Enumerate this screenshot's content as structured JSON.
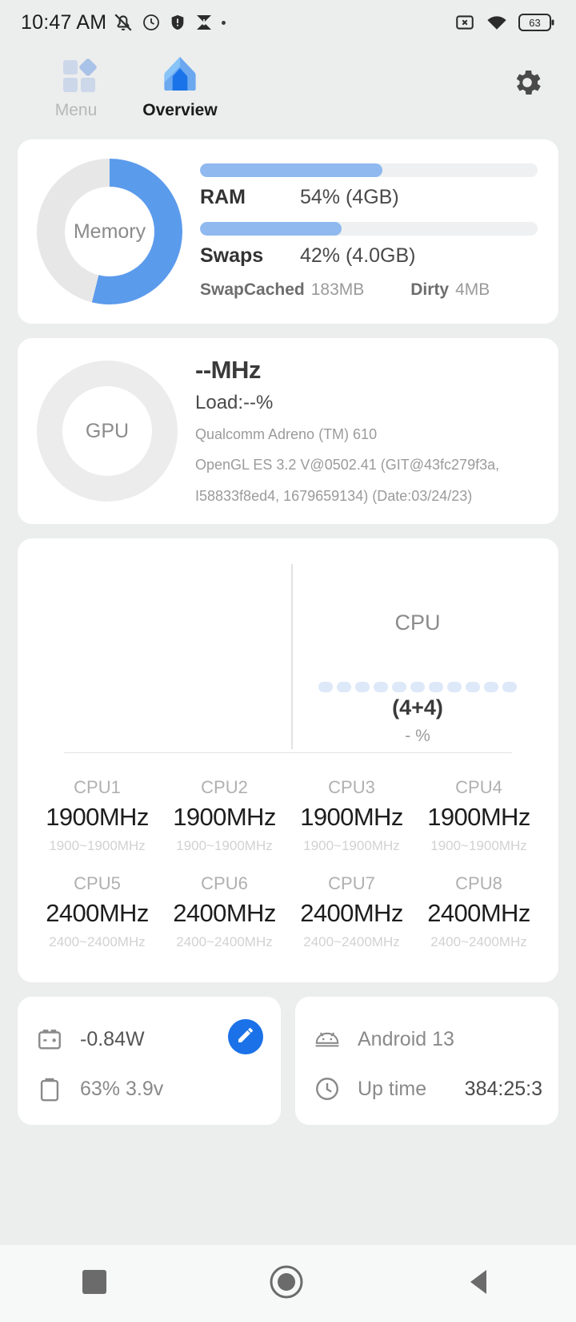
{
  "status_bar": {
    "time": "10:47 AM",
    "icons": [
      "mute-bell-icon",
      "alarm-clock-icon",
      "shield-icon",
      "sync-error-icon",
      "dot-icon"
    ],
    "right_icons": [
      "no-sim-icon",
      "wifi-icon"
    ],
    "battery_level": "63"
  },
  "tabs": [
    {
      "label": "Menu",
      "icon": "grid-menu-icon",
      "active": false
    },
    {
      "label": "Overview",
      "icon": "home-icon",
      "active": true
    }
  ],
  "settings_icon": "gear-icon",
  "memory_card": {
    "donut_label": "Memory",
    "donut_percent": 54,
    "ram": {
      "label": "RAM",
      "value": "54% (4GB)",
      "percent": 54
    },
    "swaps": {
      "label": "Swaps",
      "value": "42% (4.0GB)",
      "percent": 42
    },
    "swapcached": {
      "label": "SwapCached",
      "value": "183MB"
    },
    "dirty": {
      "label": "Dirty",
      "value": "4MB"
    }
  },
  "gpu_card": {
    "ring_label": "GPU",
    "frequency": "--MHz",
    "load": "Load:--%",
    "renderer": "Qualcomm Adreno (TM) 610",
    "version_line_1": "OpenGL ES 3.2 V@0502.41 (GIT@43fc279f3a,",
    "version_line_2": "I58833f8ed4, 1679659134) (Date:03/24/23)"
  },
  "cpu_card": {
    "title": "CPU",
    "cores_label": "(4+4)",
    "load_percent": "- %",
    "pill_count": 11,
    "cores": [
      {
        "name": "CPU1",
        "freq": "1900MHz",
        "range": "1900~1900MHz"
      },
      {
        "name": "CPU2",
        "freq": "1900MHz",
        "range": "1900~1900MHz"
      },
      {
        "name": "CPU3",
        "freq": "1900MHz",
        "range": "1900~1900MHz"
      },
      {
        "name": "CPU4",
        "freq": "1900MHz",
        "range": "1900~1900MHz"
      },
      {
        "name": "CPU5",
        "freq": "2400MHz",
        "range": "2400~2400MHz"
      },
      {
        "name": "CPU6",
        "freq": "2400MHz",
        "range": "2400~2400MHz"
      },
      {
        "name": "CPU7",
        "freq": "2400MHz",
        "range": "2400~2400MHz"
      },
      {
        "name": "CPU8",
        "freq": "2400MHz",
        "range": "2400~2400MHz"
      }
    ]
  },
  "battery_card": {
    "power_icon": "battery-charge-icon",
    "power": "-0.84W",
    "edit_icon": "pencil-icon",
    "status_icon": "battery-status-icon",
    "status": "63%  3.9v"
  },
  "system_card": {
    "android_icon": "android-icon",
    "android_version": "Android 13",
    "uptime_icon": "clock-icon",
    "uptime_label": "Up time",
    "uptime_value": "384:25:3"
  },
  "nav_bar": {
    "recents_icon": "square-icon",
    "home_icon": "circle-icon",
    "back_icon": "triangle-back-icon"
  },
  "colors": {
    "accent_blue": "#5b9bec",
    "light_blue": "#8fb9ef",
    "pill_blue": "#dde8f8",
    "fab_blue": "#1b72e8",
    "background": "#eceded",
    "card": "#ffffff"
  }
}
